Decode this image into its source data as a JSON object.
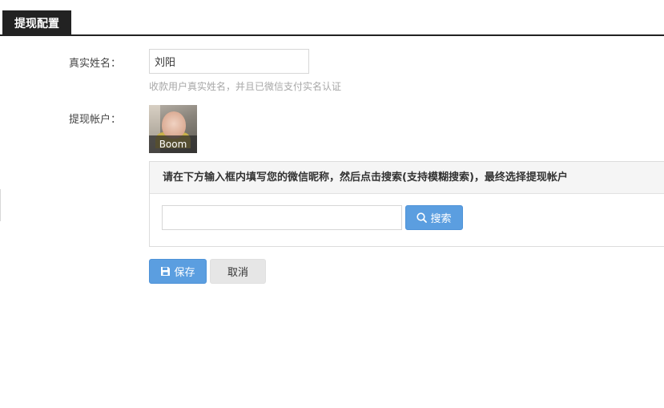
{
  "tab": {
    "title": "提现配置"
  },
  "form": {
    "real_name_label": "真实姓名：",
    "real_name_value": "刘阳",
    "real_name_hint": "收款用户真实姓名，并且已微信支付实名认证",
    "account_label": "提现帐户：",
    "account_nickname": "Boom"
  },
  "search_panel": {
    "instruction": "请在下方输入框内填写您的微信昵称，然后点击搜索(支持模糊搜索)，最终选择提现帐户",
    "input_value": "",
    "search_button_label": "搜索"
  },
  "actions": {
    "save_label": "保存",
    "cancel_label": "取消"
  },
  "colors": {
    "primary": "#5b9ee0",
    "tab_bg": "#222222"
  },
  "icons": {
    "search": "search-icon",
    "save": "floppy-disk-icon"
  }
}
